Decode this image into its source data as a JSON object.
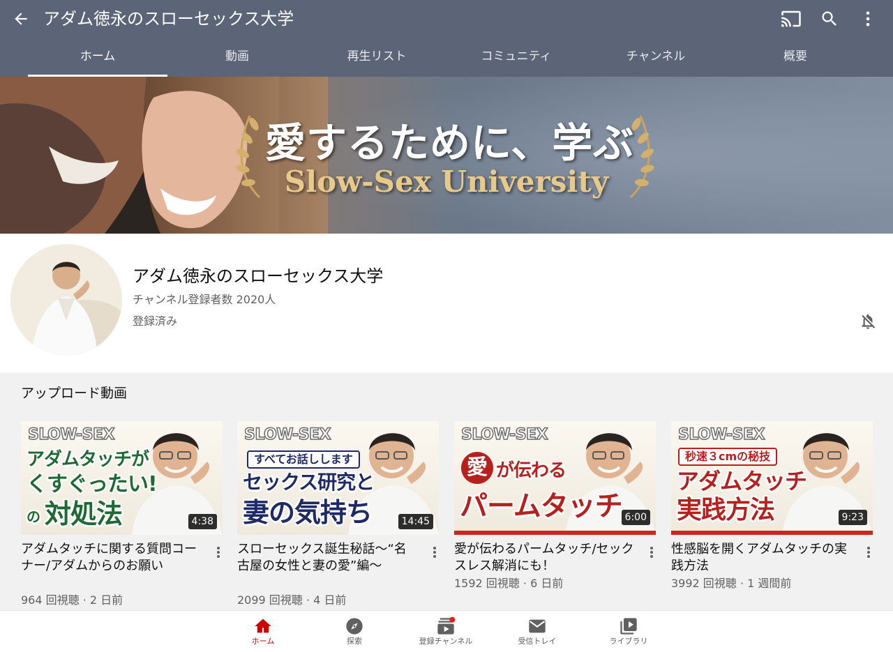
{
  "appbar": {
    "title": "アダム徳永のスローセックス大学",
    "icons": [
      "back-arrow-icon",
      "cast-icon",
      "search-icon",
      "more-vert-icon"
    ]
  },
  "tabs": [
    {
      "label": "ホーム",
      "active": true
    },
    {
      "label": "動画"
    },
    {
      "label": "再生リスト"
    },
    {
      "label": "コミュニティ"
    },
    {
      "label": "チャンネル"
    },
    {
      "label": "概要"
    }
  ],
  "banner": {
    "main_text": "愛するために、学ぶ",
    "sub_text": "Slow-Sex University"
  },
  "channel": {
    "name": "アダム徳永のスローセックス大学",
    "subscribers": "チャンネル登録者数 2020人",
    "status": "登録済み",
    "bell_icon": "bell-off-icon"
  },
  "uploads": {
    "title": "アップロード動画",
    "videos": [
      {
        "thumb_brand": "SLOW-SEX",
        "thumb_line1": "アダムタッチが",
        "thumb_line2": "くすぐったい!",
        "thumb_line3_small": "の",
        "thumb_line3": "対処法",
        "duration": "4:38",
        "title": "アダムタッチに関する質問コーナー/アダムからのお願い",
        "meta": "964 回視聴 · 2 日前"
      },
      {
        "thumb_brand": "SLOW-SEX",
        "thumb_box": "すべてお話しします",
        "thumb_line1": "セックス研究と",
        "thumb_line2": "妻の気持ち",
        "duration": "14:45",
        "title": "スローセックス誕生秘話〜“名古屋の女性と妻の愛”編〜",
        "meta": "2099 回視聴 · 4 日前"
      },
      {
        "thumb_brand": "SLOW-SEX",
        "thumb_heart": "愛",
        "thumb_line1": "が伝わる",
        "thumb_line2": "パームタッチ",
        "duration": "6:00",
        "title": "愛が伝わるパームタッチ/セックスレス解消にも！",
        "meta": "1592 回視聴 · 6 日前"
      },
      {
        "thumb_brand": "SLOW-SEX",
        "thumb_box": "秒速３cmの秘技",
        "thumb_line1": "アダムタッチ",
        "thumb_line2": "実践方法",
        "duration": "9:23",
        "title": "性感脳を開くアダムタッチの実践方法",
        "meta": "3992 回視聴 · 1 週間前"
      }
    ]
  },
  "bottom_nav": [
    {
      "label": "ホーム",
      "icon": "home-icon",
      "active": true
    },
    {
      "label": "探索",
      "icon": "explore-icon"
    },
    {
      "label": "登録チャンネル",
      "icon": "subscriptions-icon"
    },
    {
      "label": "受信トレイ",
      "icon": "inbox-mail-icon"
    },
    {
      "label": "ライブラリ",
      "icon": "library-icon"
    }
  ],
  "colors": {
    "appbar_bg": "#5b6577",
    "accent_red": "#cc0000",
    "thumb_green": "#1f6a34",
    "thumb_navy": "#1d2a66",
    "thumb_red": "#b6211f",
    "banner_gold": "#e7c98b"
  }
}
